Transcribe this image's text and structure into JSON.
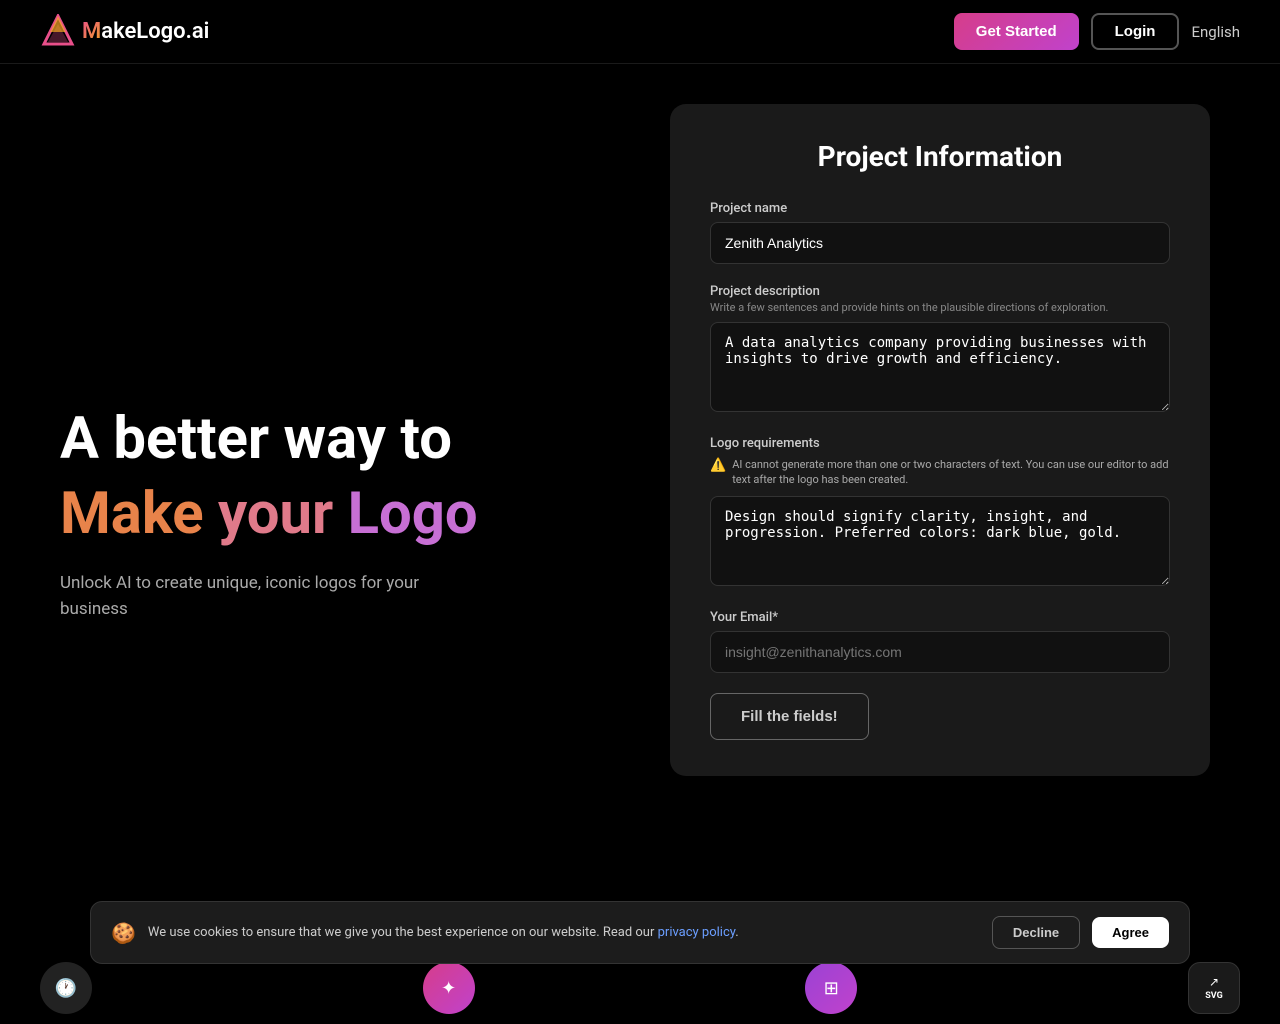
{
  "header": {
    "logo_letter_m": "M",
    "logo_text": "akeLogo.ai",
    "get_started_label": "Get Started",
    "login_label": "Login",
    "language_label": "English"
  },
  "hero": {
    "line1": "A better way to",
    "word_make": "Make",
    "word_your": "your",
    "word_logo": "Logo",
    "subtitle_line1": "Unlock AI to create unique, iconic logos for your",
    "subtitle_line2": "business"
  },
  "form": {
    "title": "Project Information",
    "project_name_label": "Project name",
    "project_name_value": "Zenith Analytics",
    "project_desc_label": "Project description",
    "project_desc_sublabel": "Write a few sentences and provide hints on the plausible directions of exploration.",
    "project_desc_value": "A data analytics company providing businesses with insights to drive growth and efficiency.",
    "logo_req_label": "Logo requirements",
    "logo_req_warning": "AI cannot generate more than one or two characters of text. You can use our editor to add text after the logo has been created.",
    "logo_req_value": "Design should signify clarity, insight, and progression. Preferred colors: dark blue, gold.",
    "email_label": "Your Email*",
    "email_placeholder": "insight@zenithanalytics.com",
    "submit_label": "Fill the fields!"
  },
  "cookie": {
    "text": "We use cookies to ensure that we give you the best experience on our website. Read our",
    "link_text": "privacy policy",
    "decline_label": "Decline",
    "agree_label": "Agree"
  },
  "bottom_icons": {
    "clock_icon": "🕐",
    "svg_label": "SVG"
  }
}
